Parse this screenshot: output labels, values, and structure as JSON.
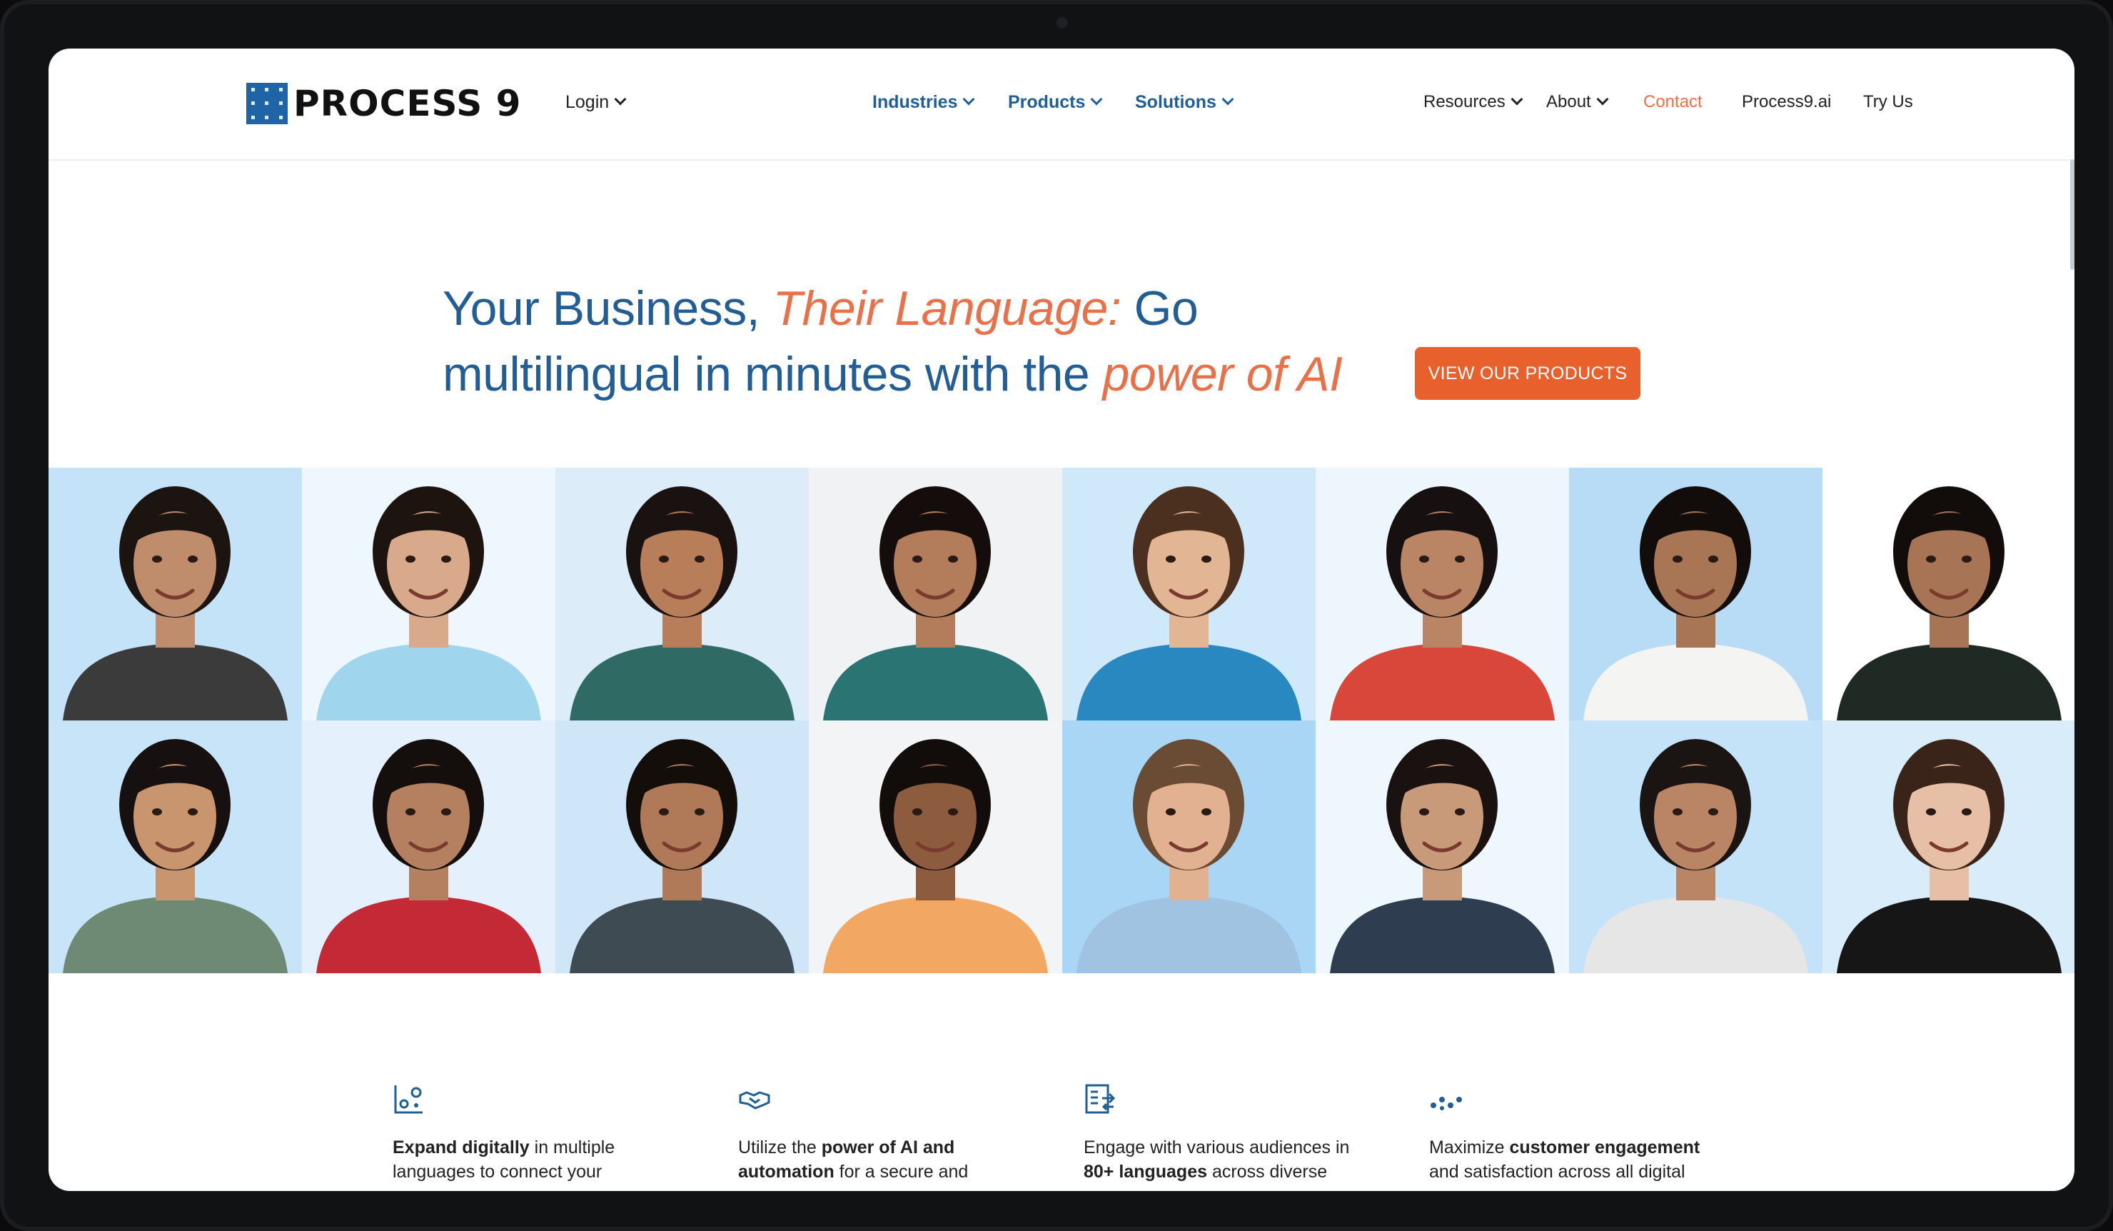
{
  "header": {
    "logo_text": "PROCESS 9",
    "login": "Login",
    "main_nav": [
      "Industries",
      "Products",
      "Solutions"
    ],
    "secondary_nav": [
      "Resources",
      "About"
    ],
    "contact": "Contact",
    "process9_ai": "Process9.ai",
    "try_us": "Try Us"
  },
  "hero": {
    "title_part1": "Your Business, ",
    "title_emphasis1": "Their Language:",
    "title_part2": " Go multilingual in minutes with the ",
    "title_emphasis2": "power of AI",
    "cta_label": "VIEW OUR PRODUCTS"
  },
  "people_grid": {
    "tiles": [
      {
        "bg": "#c5e3f8",
        "shirt": "#3b3b3b",
        "hair": "#1b1411",
        "skin": "#c08d6c",
        "name": "man-beard"
      },
      {
        "bg": "#eef7fd",
        "shirt": "#9fd6ee",
        "hair": "#1d1410",
        "skin": "#d8a98a",
        "name": "woman-polo"
      },
      {
        "bg": "#dcedf9",
        "shirt": "#2f6a64",
        "hair": "#1a1210",
        "skin": "#b77e59",
        "name": "woman-curly"
      },
      {
        "bg": "#f1f2f3",
        "shirt": "#2a7474",
        "hair": "#140d0b",
        "skin": "#b37c5b",
        "name": "woman-smile"
      },
      {
        "bg": "#cfe8fa",
        "shirt": "#2a88c0",
        "hair": "#4b2f1f",
        "skin": "#e2b595",
        "name": "young-man"
      },
      {
        "bg": "#ecf6fc",
        "shirt": "#d9473a",
        "hair": "#161010",
        "skin": "#b98564",
        "name": "woman-saree"
      },
      {
        "bg": "#b8dbf6",
        "shirt": "#f4f4f2",
        "hair": "#120d0b",
        "skin": "#a87655",
        "name": "man-white-shirt"
      },
      {
        "bg": "#ffffff",
        "shirt": "#1f2a25",
        "hair": "#120c0a",
        "skin": "#a77456",
        "name": "man-dark-shirt"
      },
      {
        "bg": "#c8e4f8",
        "shirt": "#6f8a74",
        "hair": "#161010",
        "skin": "#c9956f",
        "name": "woman-long-hair"
      },
      {
        "bg": "#e4f1fc",
        "shirt": "#c42a35",
        "hair": "#140e0c",
        "skin": "#b5805f",
        "name": "woman-red-kurta"
      },
      {
        "bg": "#cfe6f8",
        "shirt": "#3e4b52",
        "hair": "#140e0b",
        "skin": "#b07a58",
        "name": "man-kurta"
      },
      {
        "bg": "#f3f4f5",
        "shirt": "#f2a863",
        "hair": "#120c0a",
        "skin": "#8d5c3f",
        "name": "man-orange-polo"
      },
      {
        "bg": "#a9d6f5",
        "shirt": "#9fc3e0",
        "hair": "#6a4b33",
        "skin": "#e1b192",
        "name": "man-tie"
      },
      {
        "bg": "#eef7fd",
        "shirt": "#2e3d4f",
        "hair": "#1a1211",
        "skin": "#c99a7a",
        "name": "woman-smile-2"
      },
      {
        "bg": "#c4e2f8",
        "shirt": "#e6e6e6",
        "hair": "#1a1412",
        "skin": "#b98565",
        "name": "man-glasses"
      },
      {
        "bg": "#d9ecfa",
        "shirt": "#161616",
        "hair": "#3a2419",
        "skin": "#e7bfa7",
        "name": "woman-curly-black"
      }
    ]
  },
  "features": [
    {
      "icon": "growth-chart-icon",
      "bold": "Expand digitally",
      "text": " in multiple languages to connect your"
    },
    {
      "icon": "handshake-icon",
      "pre": "Utilize the ",
      "bold": "power of AI and automation",
      "text": " for a secure and"
    },
    {
      "icon": "languages-list-icon",
      "pre": "Engage with various audiences in ",
      "bold": "80+ languages",
      "text": " across diverse"
    },
    {
      "icon": "nodes-icon",
      "pre": "Maximize ",
      "bold": "customer engagement",
      "text": " and satisfaction across all digital"
    }
  ]
}
